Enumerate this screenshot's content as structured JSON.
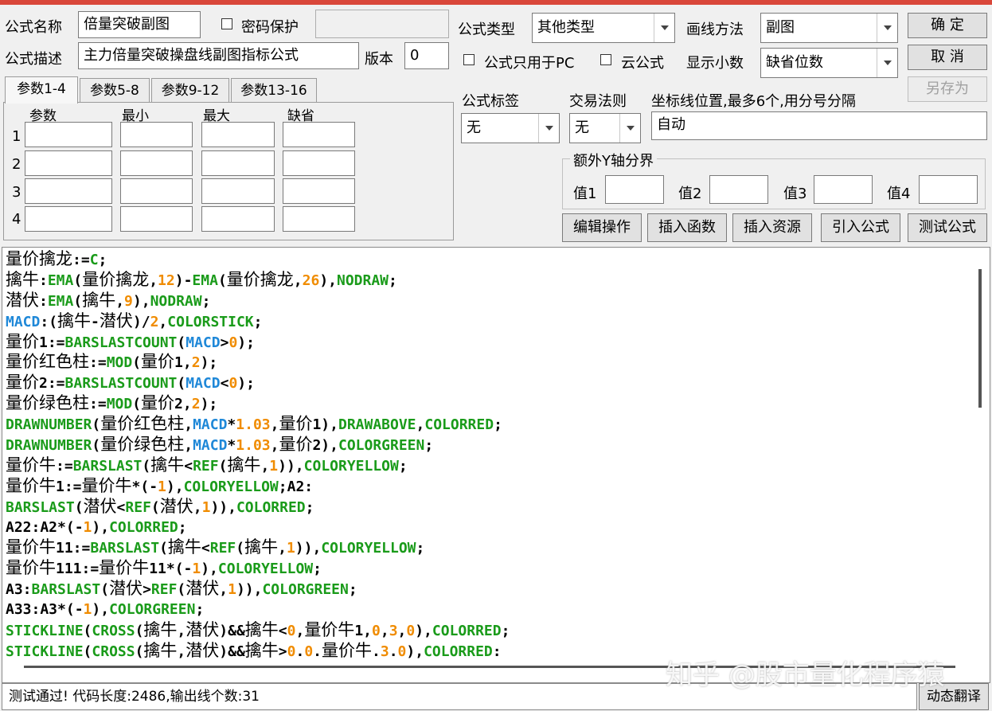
{
  "header": {
    "name_label": "公式名称",
    "name_value": "倍量突破副图",
    "password_label": "密码保护",
    "desc_label": "公式描述",
    "desc_value": "主力倍量突破操盘线副图指标公式",
    "version_label": "版本",
    "version_value": "0",
    "type_label": "公式类型",
    "type_value": "其他类型",
    "draw_label": "画线方法",
    "draw_value": "副图",
    "pc_only_label": "公式只用于PC",
    "cloud_label": "云公式",
    "decimals_label": "显示小数",
    "decimals_value": "缺省位数"
  },
  "buttons": {
    "ok": "确  定",
    "cancel": "取  消",
    "save_as": "另存为"
  },
  "params": {
    "tabs": [
      "参数1-4",
      "参数5-8",
      "参数9-12",
      "参数13-16"
    ],
    "columns": [
      "参数",
      "最小",
      "最大",
      "缺省"
    ],
    "rows": [
      "1",
      "2",
      "3",
      "4"
    ]
  },
  "right": {
    "tag_label": "公式标签",
    "tag_value": "无",
    "rule_label": "交易法则",
    "rule_value": "无",
    "coord_label": "坐标线位置,最多6个,用分号分隔",
    "coord_value": "自动",
    "yaxis_title": "额外Y轴分界",
    "yvals": [
      "值1",
      "值2",
      "值3",
      "值4"
    ]
  },
  "tools": [
    "编辑操作",
    "插入函数",
    "插入资源",
    "引入公式",
    "测试公式"
  ],
  "status": {
    "text": "测试通过! 代码长度:2486,输出线个数:31",
    "dyn_button": "动态翻译"
  },
  "watermark": "知乎 @股市量化程序猿",
  "code_lines": [
    [
      [
        "z",
        "量价擒龙"
      ],
      [
        "t",
        ":="
      ],
      [
        "k",
        "C"
      ],
      [
        "t",
        ";"
      ]
    ],
    [
      [
        "z",
        "擒牛"
      ],
      [
        "t",
        ":"
      ],
      [
        "k",
        "EMA"
      ],
      [
        "t",
        "("
      ],
      [
        "z",
        "量价擒龙"
      ],
      [
        "t",
        ","
      ],
      [
        "n",
        "12"
      ],
      [
        "t",
        ")-"
      ],
      [
        "k",
        "EMA"
      ],
      [
        "t",
        "("
      ],
      [
        "z",
        "量价擒龙"
      ],
      [
        "t",
        ","
      ],
      [
        "n",
        "26"
      ],
      [
        "t",
        "),"
      ],
      [
        "k",
        "NODRAW"
      ],
      [
        "t",
        ";"
      ]
    ],
    [
      [
        "z",
        "潜伏"
      ],
      [
        "t",
        ":"
      ],
      [
        "k",
        "EMA"
      ],
      [
        "t",
        "("
      ],
      [
        "z",
        "擒牛"
      ],
      [
        "t",
        ","
      ],
      [
        "n",
        "9"
      ],
      [
        "t",
        "),"
      ],
      [
        "k",
        "NODRAW"
      ],
      [
        "t",
        ";"
      ]
    ],
    [
      [
        "b",
        "MACD"
      ],
      [
        "t",
        ":("
      ],
      [
        "z",
        "擒牛"
      ],
      [
        "t",
        "-"
      ],
      [
        "z",
        "潜伏"
      ],
      [
        "t",
        ")/"
      ],
      [
        "n",
        "2"
      ],
      [
        "t",
        ","
      ],
      [
        "k",
        "COLORSTICK"
      ],
      [
        "t",
        ";"
      ]
    ],
    [
      [
        "z",
        "量价"
      ],
      [
        "t",
        "1:="
      ],
      [
        "k",
        "BARSLASTCOUNT"
      ],
      [
        "t",
        "("
      ],
      [
        "b",
        "MACD"
      ],
      [
        "t",
        ">"
      ],
      [
        "n",
        "0"
      ],
      [
        "t",
        ");"
      ]
    ],
    [
      [
        "z",
        "量价红色柱"
      ],
      [
        "t",
        ":="
      ],
      [
        "k",
        "MOD"
      ],
      [
        "t",
        "("
      ],
      [
        "z",
        "量价"
      ],
      [
        "t",
        "1,"
      ],
      [
        "n",
        "2"
      ],
      [
        "t",
        ");"
      ]
    ],
    [
      [
        "z",
        "量价"
      ],
      [
        "t",
        "2:="
      ],
      [
        "k",
        "BARSLASTCOUNT"
      ],
      [
        "t",
        "("
      ],
      [
        "b",
        "MACD"
      ],
      [
        "t",
        "<"
      ],
      [
        "n",
        "0"
      ],
      [
        "t",
        ");"
      ]
    ],
    [
      [
        "z",
        "量价绿色柱"
      ],
      [
        "t",
        ":="
      ],
      [
        "k",
        "MOD"
      ],
      [
        "t",
        "("
      ],
      [
        "z",
        "量价"
      ],
      [
        "t",
        "2,"
      ],
      [
        "n",
        "2"
      ],
      [
        "t",
        ");"
      ]
    ],
    [
      [
        "k",
        "DRAWNUMBER"
      ],
      [
        "t",
        "("
      ],
      [
        "z",
        "量价红色柱"
      ],
      [
        "t",
        ","
      ],
      [
        "b",
        "MACD"
      ],
      [
        "t",
        "*"
      ],
      [
        "n",
        "1.03"
      ],
      [
        "t",
        ","
      ],
      [
        "z",
        "量价"
      ],
      [
        "t",
        "1),"
      ],
      [
        "k",
        "DRAWABOVE"
      ],
      [
        "t",
        ","
      ],
      [
        "k",
        "COLORRED"
      ],
      [
        "t",
        ";"
      ]
    ],
    [
      [
        "k",
        "DRAWNUMBER"
      ],
      [
        "t",
        "("
      ],
      [
        "z",
        "量价绿色柱"
      ],
      [
        "t",
        ","
      ],
      [
        "b",
        "MACD"
      ],
      [
        "t",
        "*"
      ],
      [
        "n",
        "1.03"
      ],
      [
        "t",
        ","
      ],
      [
        "z",
        "量价"
      ],
      [
        "t",
        "2),"
      ],
      [
        "k",
        "COLORGREEN"
      ],
      [
        "t",
        ";"
      ]
    ],
    [
      [
        "z",
        "量价牛"
      ],
      [
        "t",
        ":="
      ],
      [
        "k",
        "BARSLAST"
      ],
      [
        "t",
        "("
      ],
      [
        "z",
        "擒牛"
      ],
      [
        "t",
        "<"
      ],
      [
        "k",
        "REF"
      ],
      [
        "t",
        "("
      ],
      [
        "z",
        "擒牛"
      ],
      [
        "t",
        ","
      ],
      [
        "n",
        "1"
      ],
      [
        "t",
        ")),"
      ],
      [
        "k",
        "COLORYELLOW"
      ],
      [
        "t",
        ";"
      ]
    ],
    [
      [
        "z",
        "量价牛"
      ],
      [
        "t",
        "1:="
      ],
      [
        "z",
        "量价牛"
      ],
      [
        "t",
        "*(-"
      ],
      [
        "n",
        "1"
      ],
      [
        "t",
        "),"
      ],
      [
        "k",
        "COLORYELLOW"
      ],
      [
        "t",
        ";A2:"
      ]
    ],
    [
      [
        "k",
        "BARSLAST"
      ],
      [
        "t",
        "("
      ],
      [
        "z",
        "潜伏"
      ],
      [
        "t",
        "<"
      ],
      [
        "k",
        "REF"
      ],
      [
        "t",
        "("
      ],
      [
        "z",
        "潜伏"
      ],
      [
        "t",
        ","
      ],
      [
        "n",
        "1"
      ],
      [
        "t",
        ")),"
      ],
      [
        "k",
        "COLORRED"
      ],
      [
        "t",
        ";"
      ]
    ],
    [
      [
        "t",
        "A22:A2*(-"
      ],
      [
        "n",
        "1"
      ],
      [
        "t",
        "),"
      ],
      [
        "k",
        "COLORRED"
      ],
      [
        "t",
        ";"
      ]
    ],
    [
      [
        "z",
        "量价牛"
      ],
      [
        "t",
        "11:="
      ],
      [
        "k",
        "BARSLAST"
      ],
      [
        "t",
        "("
      ],
      [
        "z",
        "擒牛"
      ],
      [
        "t",
        "<"
      ],
      [
        "k",
        "REF"
      ],
      [
        "t",
        "("
      ],
      [
        "z",
        "擒牛"
      ],
      [
        "t",
        ","
      ],
      [
        "n",
        "1"
      ],
      [
        "t",
        ")),"
      ],
      [
        "k",
        "COLORYELLOW"
      ],
      [
        "t",
        ";"
      ]
    ],
    [
      [
        "z",
        "量价牛"
      ],
      [
        "t",
        "111:="
      ],
      [
        "z",
        "量价牛"
      ],
      [
        "t",
        "11*(-"
      ],
      [
        "n",
        "1"
      ],
      [
        "t",
        "),"
      ],
      [
        "k",
        "COLORYELLOW"
      ],
      [
        "t",
        ";"
      ]
    ],
    [
      [
        "t",
        "A3:"
      ],
      [
        "k",
        "BARSLAST"
      ],
      [
        "t",
        "("
      ],
      [
        "z",
        "潜伏"
      ],
      [
        "t",
        ">"
      ],
      [
        "k",
        "REF"
      ],
      [
        "t",
        "("
      ],
      [
        "z",
        "潜伏"
      ],
      [
        "t",
        ","
      ],
      [
        "n",
        "1"
      ],
      [
        "t",
        ")),"
      ],
      [
        "k",
        "COLORGREEN"
      ],
      [
        "t",
        ";"
      ]
    ],
    [
      [
        "t",
        "A33:A3*(-"
      ],
      [
        "n",
        "1"
      ],
      [
        "t",
        "),"
      ],
      [
        "k",
        "COLORGREEN"
      ],
      [
        "t",
        ";"
      ]
    ],
    [
      [
        "k",
        "STICKLINE"
      ],
      [
        "t",
        "("
      ],
      [
        "k",
        "CROSS"
      ],
      [
        "t",
        "("
      ],
      [
        "z",
        "擒牛"
      ],
      [
        "t",
        ","
      ],
      [
        "z",
        "潜伏"
      ],
      [
        "t",
        ")&&"
      ],
      [
        "z",
        "擒牛"
      ],
      [
        "t",
        "<"
      ],
      [
        "n",
        "0"
      ],
      [
        "t",
        ","
      ],
      [
        "z",
        "量价牛"
      ],
      [
        "t",
        "1,"
      ],
      [
        "n",
        "0"
      ],
      [
        "t",
        ","
      ],
      [
        "n",
        "3"
      ],
      [
        "t",
        ","
      ],
      [
        "n",
        "0"
      ],
      [
        "t",
        "),"
      ],
      [
        "k",
        "COLORRED"
      ],
      [
        "t",
        ";"
      ]
    ],
    [
      [
        "k",
        "STICKLINE"
      ],
      [
        "t",
        "("
      ],
      [
        "k",
        "CROSS"
      ],
      [
        "t",
        "("
      ],
      [
        "z",
        "擒牛"
      ],
      [
        "t",
        ","
      ],
      [
        "z",
        "潜伏"
      ],
      [
        "t",
        ")&&"
      ],
      [
        "z",
        "擒牛"
      ],
      [
        "t",
        ">"
      ],
      [
        "n",
        "0"
      ],
      [
        "t",
        "."
      ],
      [
        "n",
        "0"
      ],
      [
        "t",
        "."
      ],
      [
        "z",
        "量价牛"
      ],
      [
        "t",
        "."
      ],
      [
        "n",
        "3"
      ],
      [
        "t",
        "."
      ],
      [
        "n",
        "0"
      ],
      [
        "t",
        "),"
      ],
      [
        "k",
        "COLORRED"
      ],
      [
        "t",
        ":"
      ]
    ]
  ],
  "colors": {
    "keyword": "#1a9b1a",
    "number": "#f08c00",
    "variable": "#1f88d8",
    "title_bar": "#d9473a"
  }
}
